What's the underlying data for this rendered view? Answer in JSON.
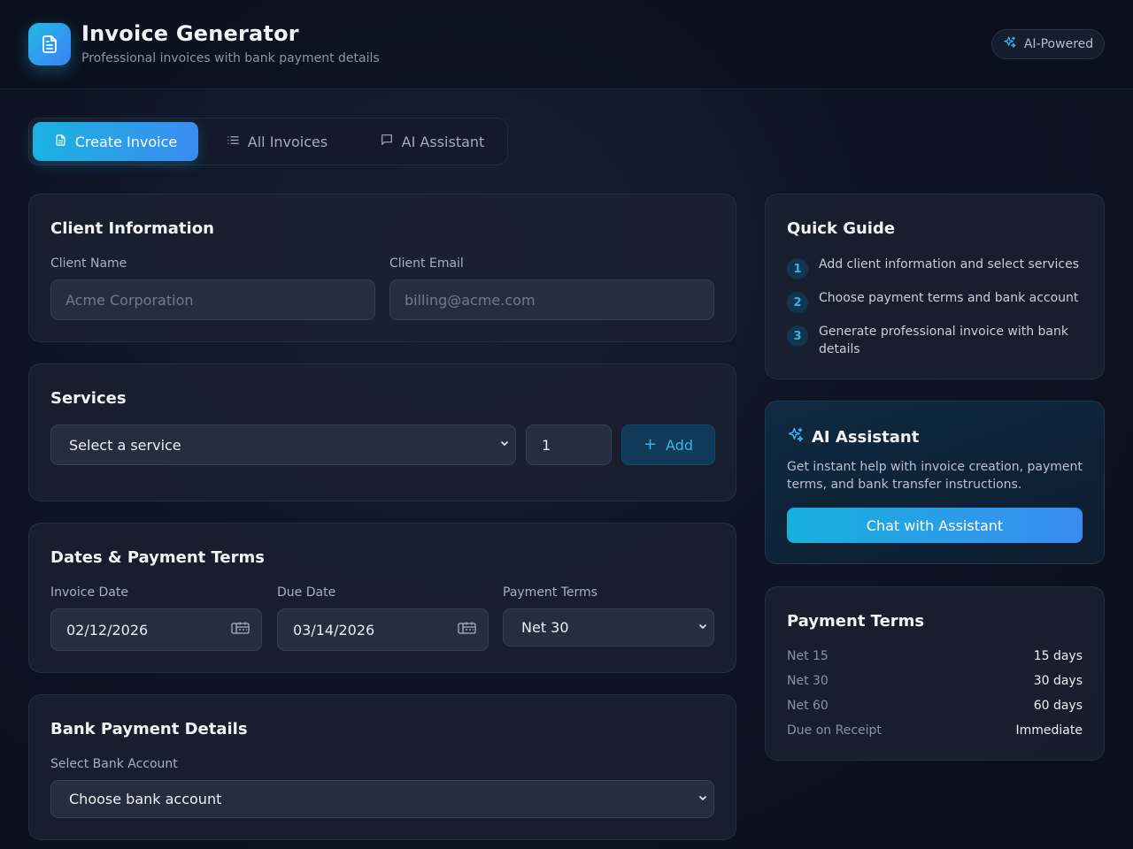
{
  "header": {
    "title": "Invoice Generator",
    "subtitle": "Professional invoices with bank payment details",
    "badge": "AI-Powered",
    "logo_icon": "document-icon"
  },
  "tabs": [
    {
      "label": "Create Invoice",
      "icon": "document-icon",
      "active": true
    },
    {
      "label": "All Invoices",
      "icon": "list-icon",
      "active": false
    },
    {
      "label": "AI Assistant",
      "icon": "chat-icon",
      "active": false
    }
  ],
  "client": {
    "title": "Client Information",
    "name_label": "Client Name",
    "name_placeholder": "Acme Corporation",
    "email_label": "Client Email",
    "email_placeholder": "billing@acme.com"
  },
  "services": {
    "title": "Services",
    "select_value": "Select a service",
    "quantity": "1",
    "add_label": "Add"
  },
  "dates": {
    "title": "Dates & Payment Terms",
    "invoice_date_label": "Invoice Date",
    "invoice_date": "02/12/2026",
    "due_date_label": "Due Date",
    "due_date": "03/14/2026",
    "terms_label": "Payment Terms",
    "terms_value": "Net 30"
  },
  "bank": {
    "title": "Bank Payment Details",
    "account_label": "Select Bank Account",
    "account_value": "Choose bank account"
  },
  "guide": {
    "title": "Quick Guide",
    "steps": [
      {
        "num": "1",
        "text": "Add client information and select services"
      },
      {
        "num": "2",
        "text": "Choose payment terms and bank account"
      },
      {
        "num": "3",
        "text": "Generate professional invoice with bank details"
      }
    ]
  },
  "assistant": {
    "title": "AI Assistant",
    "description": "Get instant help with invoice creation, payment terms, and bank transfer instructions.",
    "button": "Chat with Assistant"
  },
  "payment_terms": {
    "title": "Payment Terms",
    "rows": [
      {
        "name": "Net 15",
        "value": "15 days"
      },
      {
        "name": "Net 30",
        "value": "30 days"
      },
      {
        "name": "Net 60",
        "value": "60 days"
      },
      {
        "name": "Due on Receipt",
        "value": "Immediate"
      }
    ]
  },
  "colors": {
    "accent_start": "#1ab3e0",
    "accent_end": "#3b8cf2",
    "background": "#0e1424",
    "card": "#1b2131"
  }
}
